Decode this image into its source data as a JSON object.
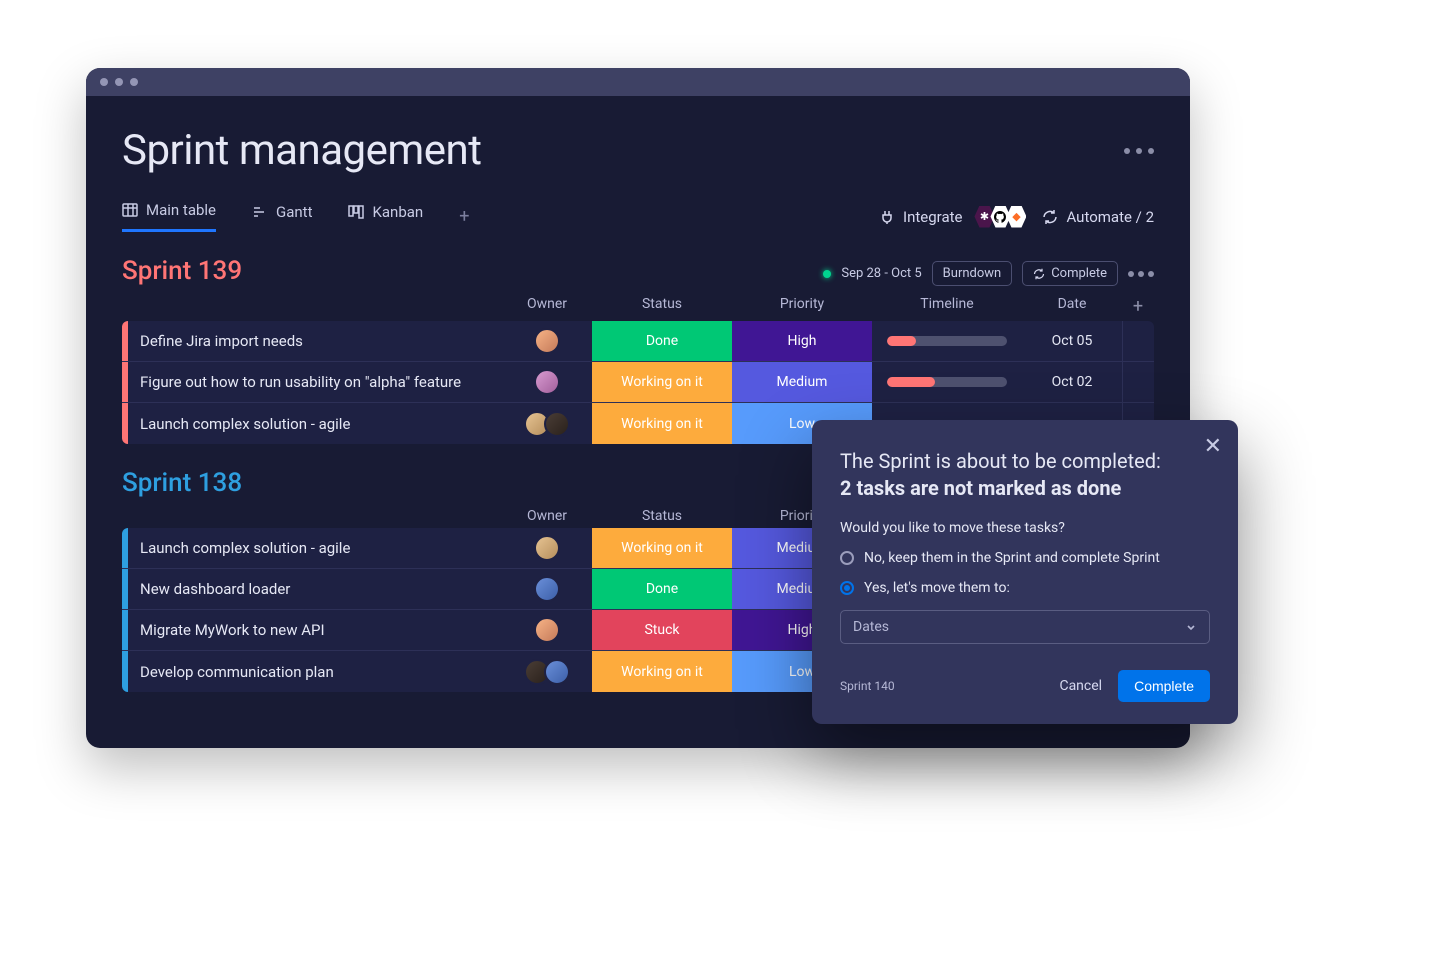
{
  "header": {
    "title": "Sprint management"
  },
  "tabs": {
    "main_table": "Main table",
    "gantt": "Gantt",
    "kanban": "Kanban"
  },
  "tools": {
    "integrate": "Integrate",
    "automate": "Automate / 2"
  },
  "sprint139": {
    "title": "Sprint 139",
    "date_range": "Sep 28 - Oct 5",
    "burndown": "Burndown",
    "complete": "Complete",
    "columns": {
      "owner": "Owner",
      "status": "Status",
      "priority": "Priority",
      "timeline": "Timeline",
      "date": "Date"
    },
    "rows": [
      {
        "task": "Define Jira import needs",
        "status": "Done",
        "priority": "High",
        "progress": 24,
        "date": "Oct 05"
      },
      {
        "task": "Figure out how to run usability on \"alpha\" feature",
        "status": "Working on it",
        "priority": "Medium",
        "progress": 40,
        "date": "Oct 02"
      },
      {
        "task": "Launch complex solution - agile",
        "status": "Working on it",
        "priority": "Low",
        "progress": 0,
        "date": ""
      }
    ]
  },
  "sprint138": {
    "title": "Sprint 138",
    "columns": {
      "owner": "Owner",
      "status": "Status",
      "priority": "Priority"
    },
    "rows": [
      {
        "task": "Launch complex solution - agile",
        "status": "Working on it",
        "priority": "Medium"
      },
      {
        "task": "New dashboard loader",
        "status": "Done",
        "priority": "Medium"
      },
      {
        "task": "Migrate MyWork to new API",
        "status": "Stuck",
        "priority": "High"
      },
      {
        "task": "Develop communication plan",
        "status": "Working on it",
        "priority": "Low"
      }
    ]
  },
  "dialog": {
    "line1": "The Sprint is about to be completed:",
    "line2": "2 tasks are not marked as done",
    "question": "Would you like to move these tasks?",
    "opt_no": "No, keep them in the Sprint and complete Sprint",
    "opt_yes": "Yes, let's move them to:",
    "select_placeholder": "Dates",
    "hint": "Sprint 140",
    "cancel": "Cancel",
    "complete": "Complete"
  },
  "status_colors": {
    "Done": "status-done",
    "Working on it": "status-working",
    "Stuck": "status-stuck"
  },
  "priority_colors": {
    "High": "prio-high",
    "Medium": "prio-medium",
    "Low": "prio-low"
  }
}
